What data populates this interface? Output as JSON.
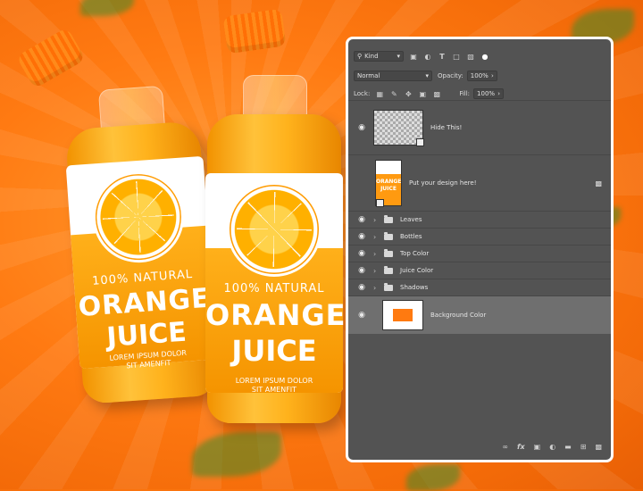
{
  "scene": {
    "bottle_left": {
      "tagline": "100% NATURAL",
      "product_line1": "ORANGE",
      "product_line2": "JUICE",
      "small_text_line1": "LOREM IPSUM DOLOR",
      "small_text_line2": "SIT AMENFIT"
    },
    "bottle_right": {
      "tagline": "100% NATURAL",
      "product_line1": "ORANGE",
      "product_line2": "JUICE",
      "small_text_line1": "LOREM IPSUM DOLOR",
      "small_text_line2": "SIT AMENFIT"
    },
    "colors": {
      "background": "#ff7a12",
      "accent": "#ff9a00"
    }
  },
  "layers_panel": {
    "filter_kind": "Kind",
    "blend_mode": "Normal",
    "opacity_label": "Opacity:",
    "opacity_value": "100%",
    "lock_label": "Lock:",
    "fill_label": "Fill:",
    "fill_value": "100%",
    "layers": [
      {
        "name": "Hide This!",
        "type": "smart-object",
        "visible": true
      },
      {
        "name": "Put your design here!",
        "type": "smart-object",
        "visible": false
      },
      {
        "name": "Leaves",
        "type": "group",
        "visible": true
      },
      {
        "name": "Bottles",
        "type": "group",
        "visible": true
      },
      {
        "name": "Top Color",
        "type": "group",
        "visible": true
      },
      {
        "name": "Juice Color",
        "type": "group",
        "visible": true
      },
      {
        "name": "Shadows",
        "type": "group",
        "visible": true
      },
      {
        "name": "Background Color",
        "type": "fill",
        "visible": true,
        "selected": true
      }
    ],
    "design_thumb_text1": "ORANGE",
    "design_thumb_text2": "JUICE",
    "footer_icons": [
      "link-icon",
      "fx-icon",
      "mask-icon",
      "adjustment-icon",
      "folder-icon",
      "new-layer-icon",
      "trash-icon"
    ]
  }
}
